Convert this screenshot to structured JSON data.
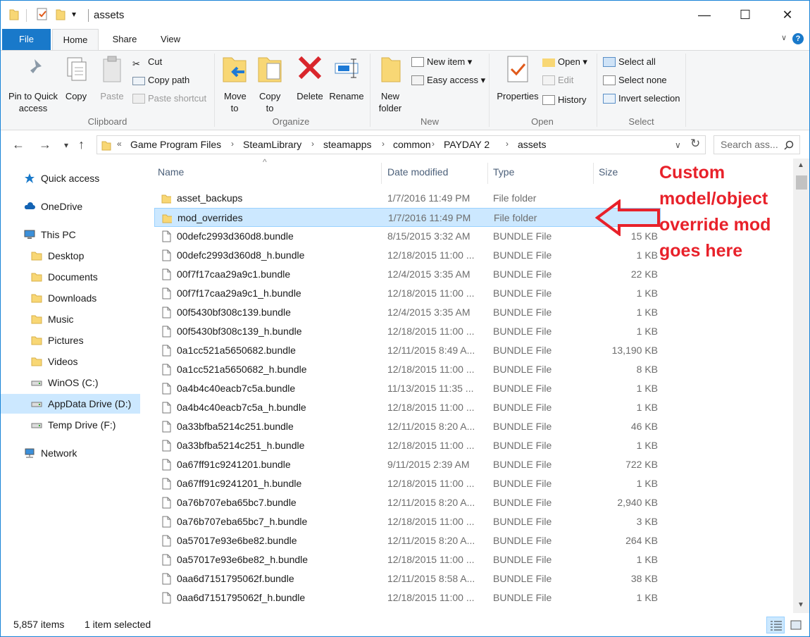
{
  "window": {
    "title": "assets",
    "controls": {
      "minimize": "—",
      "maximize": "☐",
      "close": "✕"
    }
  },
  "ribbon": {
    "tabs": [
      "File",
      "Home",
      "Share",
      "View"
    ],
    "active_tab": "Home",
    "help": "?",
    "collapse": "∨",
    "clipboard": {
      "label": "Clipboard",
      "pin": "Pin to Quick access",
      "copy": "Copy",
      "paste": "Paste",
      "cut": "Cut",
      "copy_path": "Copy path",
      "paste_shortcut": "Paste shortcut"
    },
    "organize": {
      "label": "Organize",
      "move_to": "Move to",
      "copy_to": "Copy to",
      "delete": "Delete",
      "rename": "Rename"
    },
    "new": {
      "label": "New",
      "new_folder": "New folder",
      "new_item": "New item",
      "easy_access": "Easy access"
    },
    "open": {
      "label": "Open",
      "properties": "Properties",
      "open": "Open",
      "edit": "Edit",
      "history": "History"
    },
    "select": {
      "label": "Select",
      "select_all": "Select all",
      "select_none": "Select none",
      "invert": "Invert selection"
    }
  },
  "address": {
    "overflow": "«",
    "crumbs": [
      "Game Program Files",
      "SteamLibrary",
      "steamapps",
      "common",
      "PAYDAY 2",
      "assets"
    ],
    "search_placeholder": "Search ass..."
  },
  "nav": {
    "items": [
      {
        "label": "Quick access",
        "icon": "star-icon"
      },
      {
        "label": "OneDrive",
        "icon": "cloud-icon"
      },
      {
        "label": "This PC",
        "icon": "computer-icon"
      },
      {
        "label": "Desktop",
        "icon": "folder-icon"
      },
      {
        "label": "Documents",
        "icon": "folder-icon"
      },
      {
        "label": "Downloads",
        "icon": "folder-icon"
      },
      {
        "label": "Music",
        "icon": "folder-icon"
      },
      {
        "label": "Pictures",
        "icon": "folder-icon"
      },
      {
        "label": "Videos",
        "icon": "folder-icon"
      },
      {
        "label": "WinOS (C:)",
        "icon": "drive-icon"
      },
      {
        "label": "AppData Drive (D:)",
        "icon": "drive-icon"
      },
      {
        "label": "Temp Drive (F:)",
        "icon": "drive-icon"
      },
      {
        "label": "Network",
        "icon": "network-icon"
      }
    ],
    "selected": "AppData Drive (D:)"
  },
  "columns": {
    "name": "Name",
    "date": "Date modified",
    "type": "Type",
    "size": "Size"
  },
  "files": [
    {
      "name": "asset_backups",
      "date": "1/7/2016 11:49 PM",
      "type": "File folder",
      "size": "",
      "folder": true
    },
    {
      "name": "mod_overrides",
      "date": "1/7/2016 11:49 PM",
      "type": "File folder",
      "size": "",
      "folder": true
    },
    {
      "name": "00defc2993d360d8.bundle",
      "date": "8/15/2015 3:32 AM",
      "type": "BUNDLE File",
      "size": "15 KB"
    },
    {
      "name": "00defc2993d360d8_h.bundle",
      "date": "12/18/2015 11:00 ...",
      "type": "BUNDLE File",
      "size": "1 KB"
    },
    {
      "name": "00f7f17caa29a9c1.bundle",
      "date": "12/4/2015 3:35 AM",
      "type": "BUNDLE File",
      "size": "22 KB"
    },
    {
      "name": "00f7f17caa29a9c1_h.bundle",
      "date": "12/18/2015 11:00 ...",
      "type": "BUNDLE File",
      "size": "1 KB"
    },
    {
      "name": "00f5430bf308c139.bundle",
      "date": "12/4/2015 3:35 AM",
      "type": "BUNDLE File",
      "size": "1 KB"
    },
    {
      "name": "00f5430bf308c139_h.bundle",
      "date": "12/18/2015 11:00 ...",
      "type": "BUNDLE File",
      "size": "1 KB"
    },
    {
      "name": "0a1cc521a5650682.bundle",
      "date": "12/11/2015 8:49 A...",
      "type": "BUNDLE File",
      "size": "13,190 KB"
    },
    {
      "name": "0a1cc521a5650682_h.bundle",
      "date": "12/18/2015 11:00 ...",
      "type": "BUNDLE File",
      "size": "8 KB"
    },
    {
      "name": "0a4b4c40eacb7c5a.bundle",
      "date": "11/13/2015 11:35 ...",
      "type": "BUNDLE File",
      "size": "1 KB"
    },
    {
      "name": "0a4b4c40eacb7c5a_h.bundle",
      "date": "12/18/2015 11:00 ...",
      "type": "BUNDLE File",
      "size": "1 KB"
    },
    {
      "name": "0a33bfba5214c251.bundle",
      "date": "12/11/2015 8:20 A...",
      "type": "BUNDLE File",
      "size": "46 KB"
    },
    {
      "name": "0a33bfba5214c251_h.bundle",
      "date": "12/18/2015 11:00 ...",
      "type": "BUNDLE File",
      "size": "1 KB"
    },
    {
      "name": "0a67ff91c9241201.bundle",
      "date": "9/11/2015 2:39 AM",
      "type": "BUNDLE File",
      "size": "722 KB"
    },
    {
      "name": "0a67ff91c9241201_h.bundle",
      "date": "12/18/2015 11:00 ...",
      "type": "BUNDLE File",
      "size": "1 KB"
    },
    {
      "name": "0a76b707eba65bc7.bundle",
      "date": "12/11/2015 8:20 A...",
      "type": "BUNDLE File",
      "size": "2,940 KB"
    },
    {
      "name": "0a76b707eba65bc7_h.bundle",
      "date": "12/18/2015 11:00 ...",
      "type": "BUNDLE File",
      "size": "3 KB"
    },
    {
      "name": "0a57017e93e6be82.bundle",
      "date": "12/11/2015 8:20 A...",
      "type": "BUNDLE File",
      "size": "264 KB"
    },
    {
      "name": "0a57017e93e6be82_h.bundle",
      "date": "12/18/2015 11:00 ...",
      "type": "BUNDLE File",
      "size": "1 KB"
    },
    {
      "name": "0aa6d7151795062f.bundle",
      "date": "12/11/2015 8:58 A...",
      "type": "BUNDLE File",
      "size": "38 KB"
    },
    {
      "name": "0aa6d7151795062f_h.bundle",
      "date": "12/18/2015 11:00 ...",
      "type": "BUNDLE File",
      "size": "1 KB"
    }
  ],
  "selected_file": "mod_overrides",
  "status": {
    "count": "5,857 items",
    "selection": "1 item selected"
  },
  "annotation": {
    "lines": [
      "Custom",
      "model/object",
      "override mod",
      "goes here"
    ],
    "color": "#e8212a"
  },
  "colors": {
    "accent": "#1979ca",
    "selection": "#cce8ff",
    "folder": "#f8d775"
  }
}
